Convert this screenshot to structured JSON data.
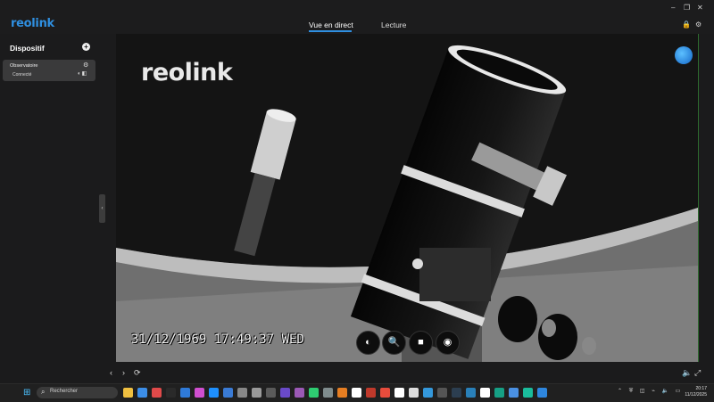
{
  "app": {
    "logo_text": "reolink"
  },
  "tabs": [
    {
      "label": "Vue en direct",
      "active": true
    },
    {
      "label": "Lecture",
      "active": false
    }
  ],
  "window_controls": {
    "minimize": "–",
    "restore": "❐",
    "close": "✕"
  },
  "titlebar_icons": {
    "lock": "lock-icon",
    "settings": "gear-icon"
  },
  "sidebar": {
    "title": "Dispositif",
    "add_symbol": "+",
    "devices": [
      {
        "name": "Observatoire",
        "status": "Connecté"
      }
    ],
    "collapse_symbol": "‹"
  },
  "video": {
    "watermark": "reolink",
    "timestamp": "31/12/1969 17:49:37 WED",
    "controls": [
      {
        "name": "ptz-icon",
        "glyph": "◐"
      },
      {
        "name": "zoom-icon",
        "glyph": "🔍"
      },
      {
        "name": "record-icon",
        "glyph": "■"
      },
      {
        "name": "snapshot-icon",
        "glyph": "◉"
      }
    ]
  },
  "bottom_bar": {
    "prev": "‹",
    "next": "›",
    "refresh": "⟳",
    "volume": "🔈",
    "fullscreen": "⤢"
  },
  "taskbar": {
    "search_placeholder": "Rechercher",
    "time": "20:17",
    "date": "11/12/2025",
    "app_colors": [
      "#f0c040",
      "#3c8ee8",
      "#e04a4a",
      "#2a2a2a",
      "#2f7ad8",
      "#d04fd0",
      "#1e90ff",
      "#3a7bd5",
      "#888",
      "#9a9a9a",
      "#5a5a5a",
      "#6a4ac8",
      "#9b59b6",
      "#2ecc71",
      "#7f8c8d",
      "#e67e22",
      "#ffffff",
      "#c0392b",
      "#e74c3c",
      "#ffffff",
      "#dddddd",
      "#3498db",
      "#555",
      "#2c3e50",
      "#2980b9",
      "#ffffff",
      "#16a085",
      "#4a90e2",
      "#1abc9c",
      "#2e86de"
    ]
  },
  "colors": {
    "accent": "#2f8fe0",
    "background": "#1b1b1c"
  }
}
